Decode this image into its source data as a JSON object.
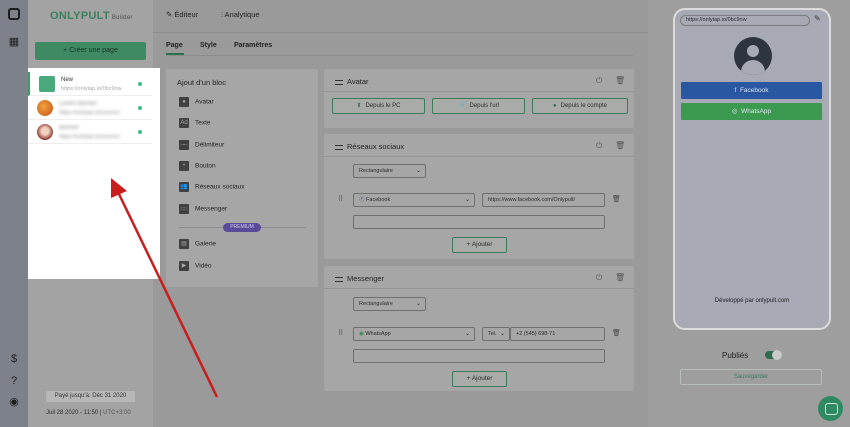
{
  "app": {
    "brand": "ONLYPULT",
    "brand_suffix": "Builder"
  },
  "sidebar": {
    "create_label": "Créer une page",
    "pages": [
      {
        "name": "New",
        "url": "https://onlytap.io/0bc9nw",
        "blurred": false
      },
      {
        "name": "Lorem blurred",
        "url": "https://onlytap.io/xxxxxxx",
        "blurred": true
      },
      {
        "name": "Blurred",
        "url": "https://onlytap.io/xxxxxxx",
        "blurred": true
      }
    ],
    "paid_until": "Payé jusqu'à: Déc 31 2020",
    "date": "Juil 28 2020 - 11:50",
    "timezone": "UTC+3:00"
  },
  "editor": {
    "tabs": [
      "Éditeur",
      "Analytique"
    ],
    "subtabs": [
      "Page",
      "Style",
      "Paramètres"
    ],
    "blocks_title": "Ajout d'un bloc",
    "blocks": [
      "Avatar",
      "Texte",
      "Délimiteur",
      "Bouton",
      "Réseaux sociaux",
      "Messenger"
    ],
    "premium_label": "PREMIUM",
    "premium_blocks": [
      "Galerie",
      "Vidéo"
    ],
    "avatar_card": {
      "title": "Avatar",
      "buttons": [
        "Depuis le PC",
        "Depuis l'url",
        "Depuis le compte"
      ]
    },
    "social_card": {
      "title": "Réseaux sociaux",
      "shape": "Rectangulaire",
      "network": "Facebook",
      "link": "https://www.facebook.com/Onlypult/",
      "add_label": "Ajouter"
    },
    "messenger_card": {
      "title": "Messenger",
      "shape": "Rectangulaire",
      "network": "WhatsApp",
      "phone_type": "Tel.",
      "phone": "+2 (545) 698-71",
      "add_label": "Ajouter"
    }
  },
  "preview": {
    "url": "https://onlytap.io/0bc9nw",
    "buttons": [
      "Facebook",
      "WhatsApp"
    ],
    "developed_by": "Développé par onlypult.com",
    "published_label": "Publiés",
    "save_label": "Sauvegarder"
  }
}
